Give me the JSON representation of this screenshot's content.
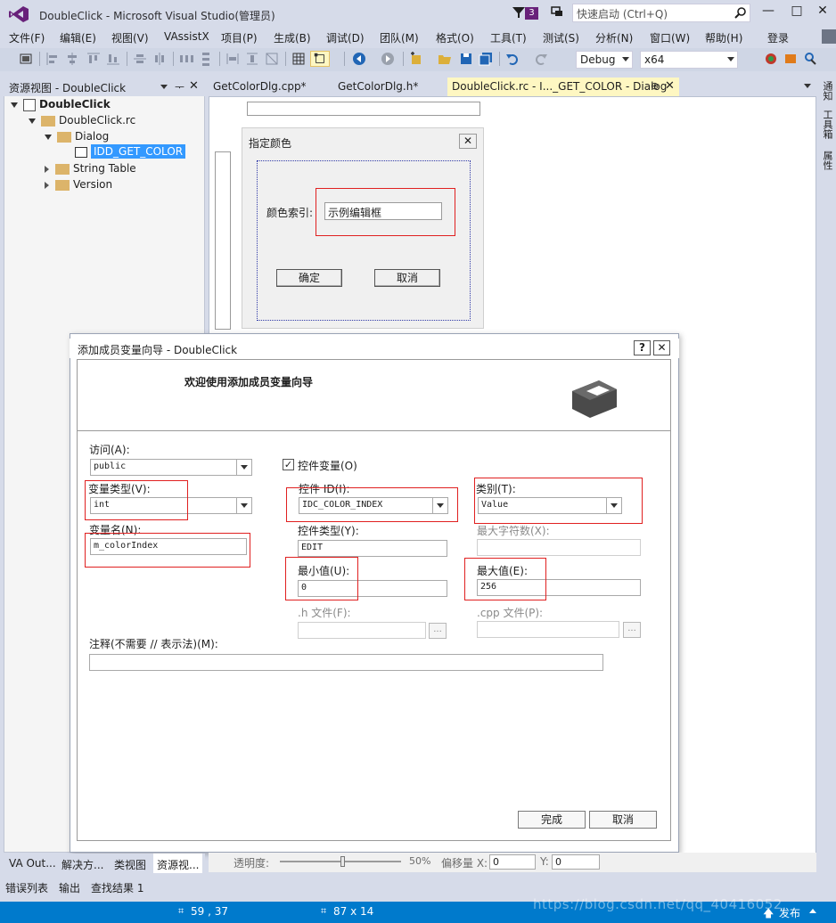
{
  "window": {
    "title": "DoubleClick - Microsoft Visual Studio(管理员)",
    "notification_count": "3",
    "quick_launch_placeholder": "快速启动 (Ctrl+Q)",
    "minimize": "—",
    "maximize": "□",
    "close": "✕"
  },
  "menu": {
    "items": [
      "文件(F)",
      "编辑(E)",
      "视图(V)",
      "VAssistX",
      "项目(P)",
      "生成(B)",
      "调试(D)",
      "团队(M)",
      "格式(O)",
      "工具(T)",
      "测试(S)",
      "分析(N)",
      "窗口(W)",
      "帮助(H)"
    ],
    "login": "登录"
  },
  "toolbar": {
    "config": "Debug",
    "platform": "x64"
  },
  "resource_view": {
    "title": "资源视图 - DoubleClick",
    "tree": [
      {
        "label": "DoubleClick",
        "bold": true
      },
      {
        "label": "DoubleClick.rc"
      },
      {
        "label": "Dialog"
      },
      {
        "label": "IDD_GET_COLOR",
        "selected": true
      },
      {
        "label": "String Table"
      },
      {
        "label": "Version"
      }
    ]
  },
  "doc_tabs": [
    {
      "label": "GetColorDlg.cpp*"
    },
    {
      "label": "GetColorDlg.h*"
    },
    {
      "label": "DoubleClick.rc - I..._GET_COLOR - Dialog",
      "active": true
    }
  ],
  "right_strip": [
    "通知",
    "工具箱",
    "属性"
  ],
  "designer": {
    "title": "指定颜色",
    "label": "颜色索引:",
    "edit_sample": "示例编辑框",
    "ok": "确定",
    "cancel": "取消"
  },
  "wizard": {
    "title": "添加成员变量向导 - DoubleClick",
    "help": "?",
    "close": "✕",
    "welcome": "欢迎使用添加成员变量向导",
    "access_label": "访问(A):",
    "access_value": "public",
    "control_var_label": "控件变量(O)",
    "control_var_checked": true,
    "var_type_label": "变量类型(V):",
    "var_type_value": "int",
    "control_id_label": "控件 ID(I):",
    "control_id_value": "IDC_COLOR_INDEX",
    "category_label": "类别(T):",
    "category_value": "Value",
    "var_name_label": "变量名(N):",
    "var_name_value": "m_colorIndex",
    "control_type_label": "控件类型(Y):",
    "control_type_value": "EDIT",
    "max_chars_label": "最大字符数(X):",
    "max_chars_value": "",
    "min_label": "最小值(U):",
    "min_value": "0",
    "max_label": "最大值(E):",
    "max_value": "256",
    "h_file_label": ".h 文件(F):",
    "cpp_file_label": ".cpp 文件(P):",
    "browse": "...",
    "comment_label": "注释(不需要 // 表示法)(M):",
    "finish": "完成",
    "cancel": "取消"
  },
  "bottom": {
    "left_tabs": [
      "VA Out...",
      "解决方...",
      "类视图",
      "资源视..."
    ],
    "opacity_label": "透明度:",
    "opacity_value": "50%",
    "offset_x_label": "偏移量 X:",
    "offset_x_value": "0",
    "offset_y_label": "Y:",
    "offset_y_value": "0",
    "output_tabs": [
      "错误列表",
      "输出",
      "查找结果 1"
    ]
  },
  "status": {
    "position": "59 , 37",
    "size": "87 x 14",
    "publish": "发布",
    "watermark": "https://blog.csdn.net/qq_40416052"
  },
  "colors": {
    "accent": "#007acc",
    "selected": "#3399ff",
    "highlight_box": "#e02020",
    "vs_purple": "#68217a"
  }
}
